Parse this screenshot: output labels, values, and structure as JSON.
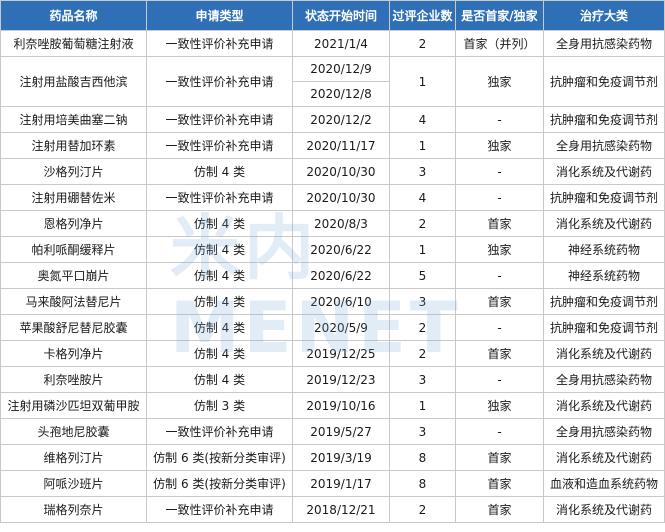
{
  "table": {
    "headers": [
      "药品名称",
      "申请类型",
      "状态开始时间",
      "过评企业数",
      "是否首家/独家",
      "治疗大类"
    ],
    "rows": [
      {
        "name": "利奈唑胺葡萄糖注射液",
        "type": "一致性评价补充申请",
        "dates": [
          "2021/1/4"
        ],
        "count": "2",
        "first": "首家（并列）",
        "category": "全身用抗感染药物"
      },
      {
        "name": "注射用盐酸吉西他滨",
        "type": "一致性评价补充申请",
        "dates": [
          "2020/12/9",
          "2020/12/8"
        ],
        "count": "1",
        "first": "独家",
        "category": "抗肿瘤和免疫调节剂"
      },
      {
        "name": "注射用培美曲塞二钠",
        "type": "一致性评价补充申请",
        "dates": [
          "2020/12/2"
        ],
        "count": "4",
        "first": "-",
        "category": "抗肿瘤和免疫调节剂"
      },
      {
        "name": "注射用替加环素",
        "type": "一致性评价补充申请",
        "dates": [
          "2020/11/17"
        ],
        "count": "1",
        "first": "独家",
        "category": "全身用抗感染药物"
      },
      {
        "name": "沙格列汀片",
        "type": "仿制 4 类",
        "dates": [
          "2020/10/30"
        ],
        "count": "3",
        "first": "-",
        "category": "消化系统及代谢药"
      },
      {
        "name": "注射用硼替佐米",
        "type": "一致性评价补充申请",
        "dates": [
          "2020/10/30"
        ],
        "count": "4",
        "first": "-",
        "category": "抗肿瘤和免疫调节剂"
      },
      {
        "name": "恩格列净片",
        "type": "仿制 4 类",
        "dates": [
          "2020/8/3"
        ],
        "count": "2",
        "first": "首家",
        "category": "消化系统及代谢药"
      },
      {
        "name": "帕利哌酮缓释片",
        "type": "仿制 4 类",
        "dates": [
          "2020/6/22"
        ],
        "count": "1",
        "first": "独家",
        "category": "神经系统药物"
      },
      {
        "name": "奥氮平口崩片",
        "type": "仿制 4 类",
        "dates": [
          "2020/6/22"
        ],
        "count": "5",
        "first": "-",
        "category": "神经系统药物"
      },
      {
        "name": "马来酸阿法替尼片",
        "type": "仿制 4 类",
        "dates": [
          "2020/6/10"
        ],
        "count": "3",
        "first": "首家",
        "category": "抗肿瘤和免疫调节剂"
      },
      {
        "name": "苹果酸舒尼替尼胶囊",
        "type": "仿制 4 类",
        "dates": [
          "2020/5/9"
        ],
        "count": "2",
        "first": "-",
        "category": "抗肿瘤和免疫调节剂"
      },
      {
        "name": "卡格列净片",
        "type": "仿制 4 类",
        "dates": [
          "2019/12/25"
        ],
        "count": "2",
        "first": "首家",
        "category": "消化系统及代谢药"
      },
      {
        "name": "利奈唑胺片",
        "type": "仿制 4 类",
        "dates": [
          "2019/12/23"
        ],
        "count": "3",
        "first": "-",
        "category": "全身用抗感染药物"
      },
      {
        "name": "注射用磷沙匹坦双葡甲胺",
        "type": "仿制 3 类",
        "dates": [
          "2019/10/16"
        ],
        "count": "1",
        "first": "独家",
        "category": "消化系统及代谢药"
      },
      {
        "name": "头孢地尼胶囊",
        "type": "一致性评价补充申请",
        "dates": [
          "2019/5/27"
        ],
        "count": "3",
        "first": "-",
        "category": "全身用抗感染药物"
      },
      {
        "name": "维格列汀片",
        "type": "仿制 6 类(按新分类审评)",
        "dates": [
          "2019/3/19"
        ],
        "count": "8",
        "first": "首家",
        "category": "消化系统及代谢药"
      },
      {
        "name": "阿哌沙班片",
        "type": "仿制 6 类(按新分类审评)",
        "dates": [
          "2019/1/17"
        ],
        "count": "8",
        "first": "首家",
        "category": "血液和造血系统药物"
      },
      {
        "name": "瑞格列奈片",
        "type": "一致性评价补充申请",
        "dates": [
          "2018/12/21"
        ],
        "count": "2",
        "first": "首家",
        "category": "消化系统及代谢药"
      }
    ]
  },
  "watermark": "米内MENET"
}
